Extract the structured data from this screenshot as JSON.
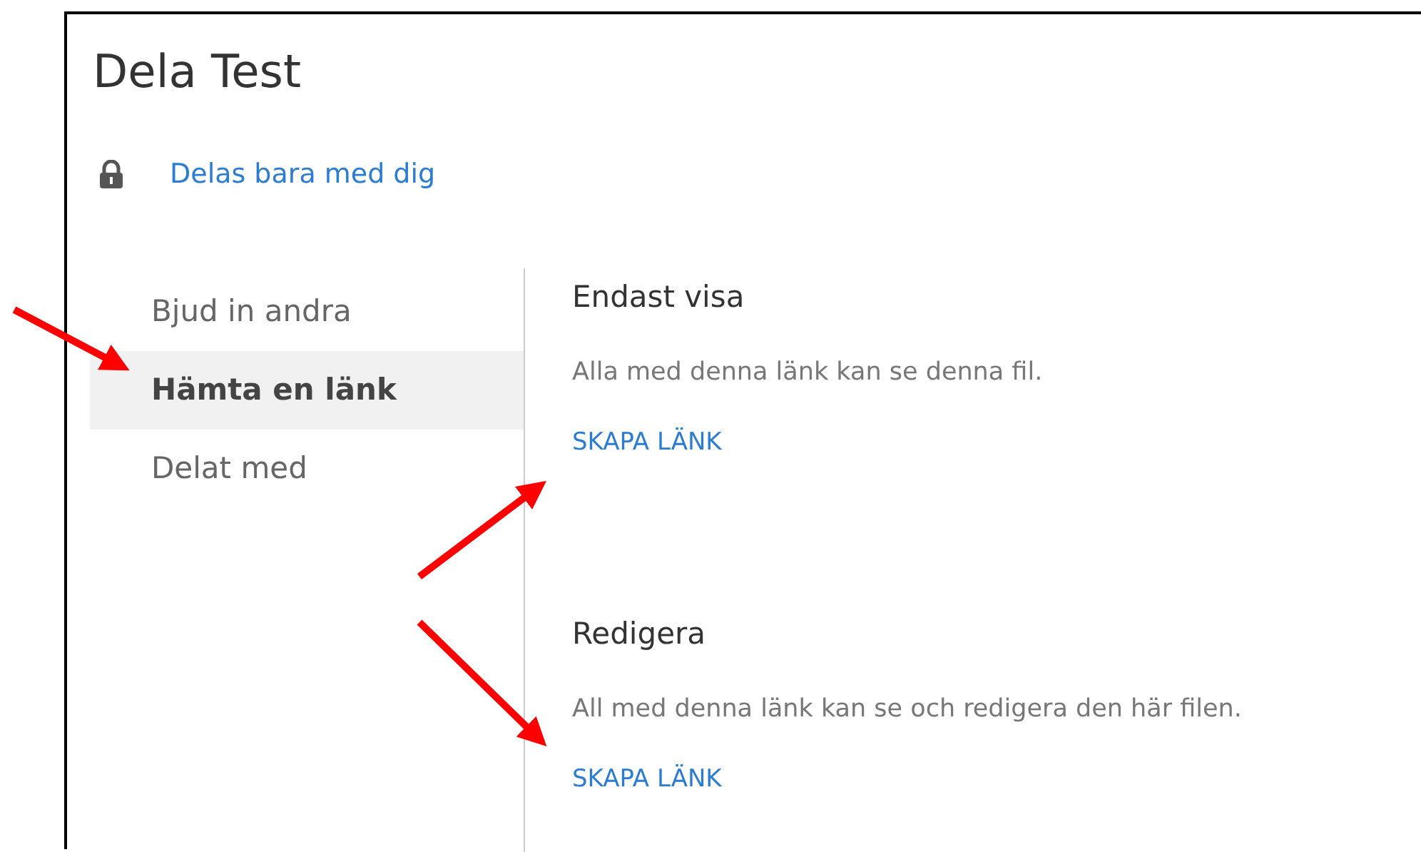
{
  "title": "Dela Test",
  "sharing_status": {
    "locked": true,
    "label": "Delas bara med dig"
  },
  "nav": [
    {
      "label": "Bjud in andra",
      "selected": false
    },
    {
      "label": "Hämta en länk",
      "selected": true
    },
    {
      "label": "Delat med",
      "selected": false
    }
  ],
  "sections": [
    {
      "heading": "Endast visa",
      "description": "Alla med denna länk kan se denna fil.",
      "action": "SKAPA LÄNK"
    },
    {
      "heading": "Redigera",
      "description": "All med denna länk kan se och redigera den här filen.",
      "action": "SKAPA LÄNK"
    }
  ]
}
